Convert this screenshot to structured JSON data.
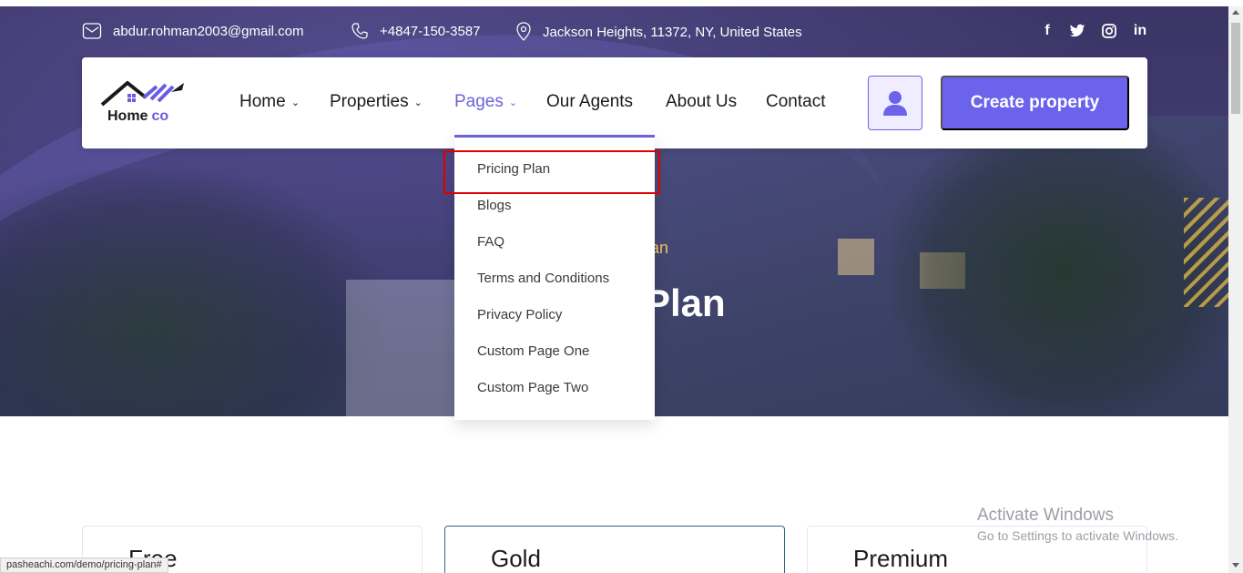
{
  "contact": {
    "email": "abdur.rohman2003@gmail.com",
    "phone": "+4847-150-3587",
    "address": "Jackson Heights, 11372, NY, United States",
    "icons": [
      "mail-icon",
      "phone-icon",
      "location-pin-icon"
    ]
  },
  "social": {
    "facebook": "f",
    "twitter_icon": "twitter-icon",
    "instagram_icon": "instagram-icon",
    "linkedin": "in"
  },
  "logo": {
    "text_main": "Home",
    "text_accent": "co"
  },
  "nav": {
    "items": [
      {
        "label": "Home"
      },
      {
        "label": "Properties"
      },
      {
        "label": "Pages"
      },
      {
        "label": "Our Agents"
      },
      {
        "label": "About Us"
      },
      {
        "label": "Contact"
      }
    ],
    "active": "Pages",
    "create_label": "Create property",
    "user_icon": "user-icon"
  },
  "dropdown": {
    "items": [
      "Pricing Plan",
      "Blogs",
      "FAQ",
      "Terms and Conditions",
      "Privacy Policy",
      "Custom Page One",
      "Custom Page Two"
    ],
    "highlighted": "Pricing Plan"
  },
  "hero": {
    "subtitle_visible": "g Plan",
    "title_visible": "Plan"
  },
  "pricing": {
    "cards": [
      {
        "title": "Free"
      },
      {
        "title": "Gold"
      },
      {
        "title": "Premium"
      }
    ]
  },
  "watermark": {
    "title": "Activate Windows",
    "subtitle": "Go to Settings to activate Windows."
  },
  "status_bar": {
    "url": "pasheachi.com/demo/pricing-plan#"
  },
  "colors": {
    "accent": "#6c63ec",
    "hero_subtitle": "#f0c35a",
    "highlight_box": "#e00000"
  }
}
